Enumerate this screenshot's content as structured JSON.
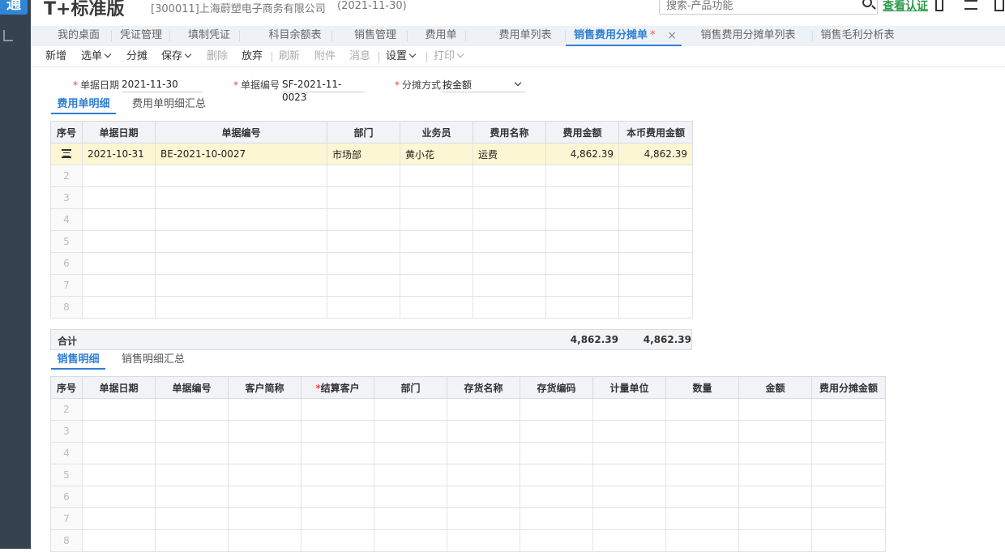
{
  "app": {
    "logo_text": "通",
    "product": "T+标准版",
    "account": "[300011]上海蔚塑电子商务有限公司",
    "date": "(2021-11-30)"
  },
  "search": {
    "placeholder": "搜索-产品功能"
  },
  "certify": "查看认证",
  "tabs": [
    "我的桌面",
    "凭证管理",
    "填制凭证",
    "科目余额表",
    "销售管理",
    "费用单",
    "费用单列表",
    "销售费用分摊单",
    "销售费用分摊单列表",
    "销售毛利分析表"
  ],
  "active_tab": {
    "label": "销售费用分摊单",
    "dirty_mark": "*",
    "close": "×"
  },
  "toolbar": {
    "new": "新增",
    "select": "选单",
    "allocate": "分摊",
    "save": "保存",
    "delete": "删除",
    "discard": "放弃",
    "refresh": "刷新",
    "attach": "附件",
    "message": "消息",
    "settings": "设置",
    "print": "打印"
  },
  "form": {
    "date_label": "单据日期",
    "date_value": "2021-11-30",
    "code_label": "单据编号",
    "code_value": "SF-2021-11-0023",
    "method_label": "分摊方式",
    "method_value": "按金额"
  },
  "expense": {
    "tab_active": "费用单明细",
    "tab_summary": "费用单明细汇总",
    "headers": [
      "序号",
      "单据日期",
      "单据编号",
      "部门",
      "业务员",
      "费用名称",
      "费用金额",
      "本币费用金额"
    ],
    "rows": [
      {
        "date": "2021-10-31",
        "code": "BE-2021-10-0027",
        "dept": "市场部",
        "staff": "黄小花",
        "name": "运费",
        "amount": "4,862.39",
        "local": "4,862.39"
      }
    ],
    "empty_rows": [
      "2",
      "3",
      "4",
      "5",
      "6",
      "7",
      "8"
    ],
    "total_label": "合计",
    "total_amount": "4,862.39",
    "total_local": "4,862.39"
  },
  "sales": {
    "tab_active": "销售明细",
    "tab_summary": "销售明细汇总",
    "headers": [
      "序号",
      "单据日期",
      "单据编号",
      "客户简称",
      "结算客户",
      "部门",
      "存货名称",
      "存货编码",
      "计量单位",
      "数量",
      "金额",
      "费用分摊金额"
    ],
    "required_mark": "*",
    "empty_rows": [
      "2",
      "3",
      "4",
      "5",
      "6",
      "7",
      "8"
    ]
  }
}
